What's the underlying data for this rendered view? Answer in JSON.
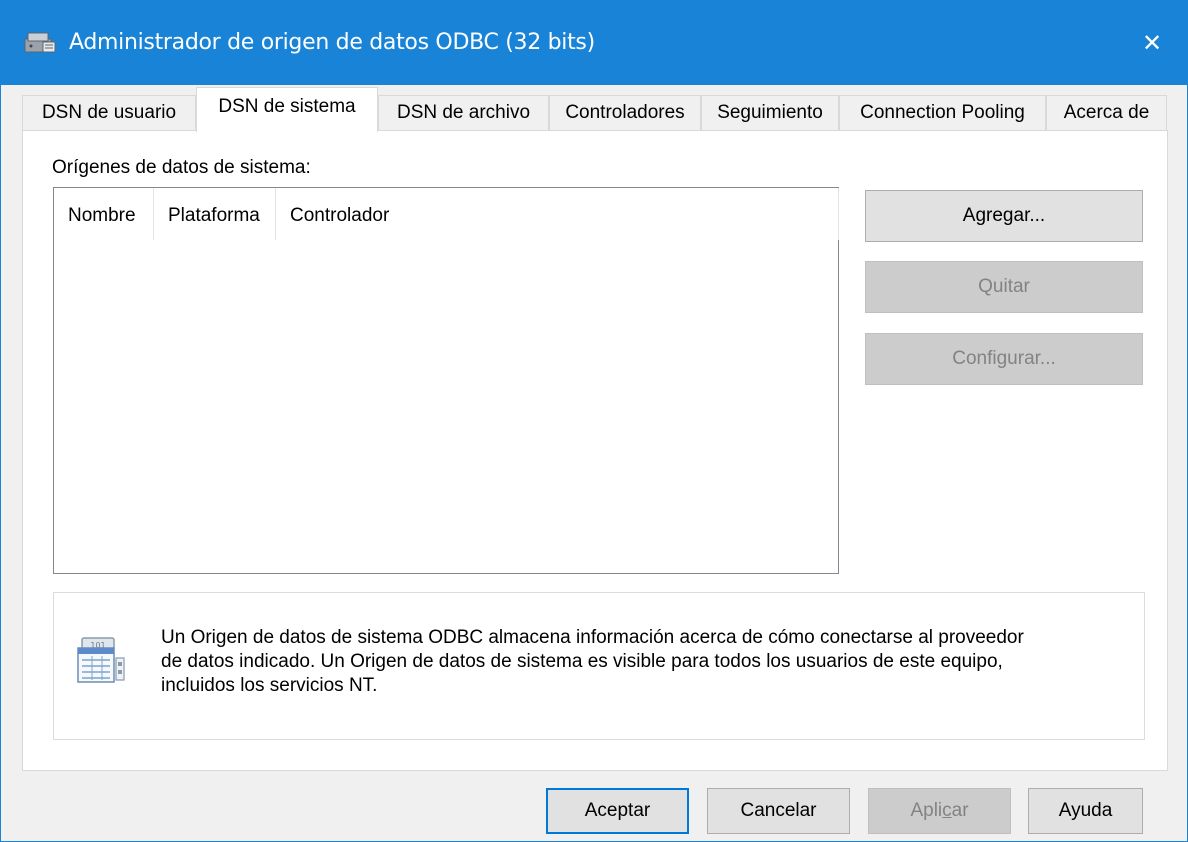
{
  "window": {
    "title": "Administrador de origen de datos ODBC (32 bits)",
    "close_symbol": "✕",
    "titlebar_color": "#1883d7"
  },
  "tabs": [
    {
      "label": "DSN de usuario",
      "active": false
    },
    {
      "label": "DSN de sistema",
      "active": true
    },
    {
      "label": "DSN de archivo",
      "active": false
    },
    {
      "label": "Controladores",
      "active": false
    },
    {
      "label": "Seguimiento",
      "active": false
    },
    {
      "label": "Connection Pooling",
      "active": false
    },
    {
      "label": "Acerca de",
      "active": false
    }
  ],
  "main": {
    "section_label": "Orígenes de datos de sistema:",
    "columns": [
      "Nombre",
      "Plataforma",
      "Controlador"
    ],
    "rows": []
  },
  "side_buttons": {
    "add": {
      "label": "Agregar...",
      "enabled": true
    },
    "remove": {
      "label": "Quitar",
      "enabled": false
    },
    "configure": {
      "label": "Configurar...",
      "enabled": false
    }
  },
  "info": {
    "icon": "data-source-icon",
    "line1": "Un Origen de datos de sistema ODBC almacena información acerca de cómo conectarse al proveedor",
    "line2": "de datos indicado. Un Origen de datos de sistema es visible para todos los usuarios de este equipo,",
    "line3": "incluidos los servicios NT."
  },
  "footer": {
    "ok": "Aceptar",
    "cancel": "Cancelar",
    "apply_prefix": "Apli",
    "apply_mnemonic": "c",
    "apply_suffix": "ar",
    "help": "Ayuda"
  }
}
